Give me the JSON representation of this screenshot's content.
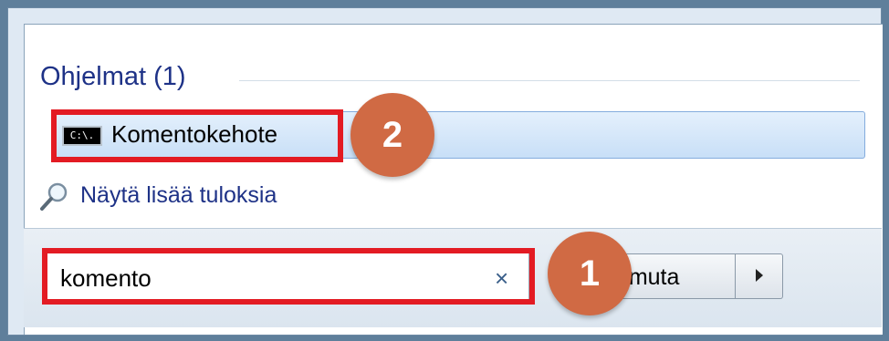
{
  "results": {
    "section_title": "Ohjelmat (1)",
    "items": [
      {
        "icon": "cmd-icon",
        "icon_text": "C:\\.",
        "label": "Komentokehote"
      }
    ],
    "more_link": "Näytä lisää tuloksia",
    "more_icon": "search-icon"
  },
  "search": {
    "value": "komento",
    "clear_glyph": "×"
  },
  "shutdown": {
    "label": "mmuta",
    "arrow_icon": "arrow-right-icon"
  },
  "annotations": {
    "badge_1": "1",
    "badge_2": "2",
    "highlight_color": "#e31b23",
    "badge_color": "#d06a44"
  }
}
